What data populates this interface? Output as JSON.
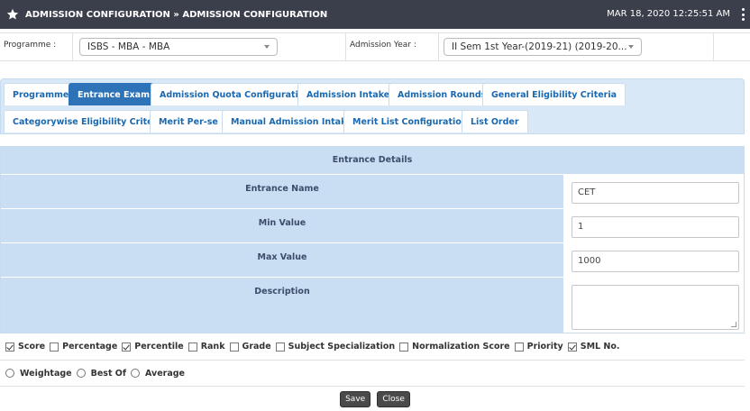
{
  "header": {
    "title": "ADMISSION CONFIGURATION » ADMISSION CONFIGURATION",
    "datetime": "MAR 18, 2020  12:25:51 AM"
  },
  "filters": {
    "programme_label": "Programme :",
    "programme_value": "ISBS - MBA - MBA",
    "admission_year_label": "Admission Year :",
    "admission_year_value": "II Sem 1st Year-(2019-21) (2019-20..."
  },
  "tabs": [
    {
      "label": "Programme",
      "active": false
    },
    {
      "label": "Entrance Exam",
      "active": true
    },
    {
      "label": "Admission Quota Configuration",
      "active": false
    },
    {
      "label": "Admission Intake",
      "active": false
    },
    {
      "label": "Admission Rounds",
      "active": false
    },
    {
      "label": "General Eligibility Criteria",
      "active": false
    },
    {
      "label": "Categorywise Eligibility Criteria",
      "active": false
    },
    {
      "label": "Merit Per-se",
      "active": false
    },
    {
      "label": "Manual Admission Intake",
      "active": false
    },
    {
      "label": "Merit List Configuration",
      "active": false
    },
    {
      "label": "List Order",
      "active": false
    }
  ],
  "details": {
    "heading": "Entrance Details",
    "fields": [
      {
        "label": "Entrance Name",
        "value": "CET"
      },
      {
        "label": "Min Value",
        "value": "1"
      },
      {
        "label": "Max Value",
        "value": "1000"
      },
      {
        "label": "Description",
        "value": ""
      }
    ]
  },
  "checkboxes": [
    {
      "label": "Score",
      "checked": true
    },
    {
      "label": "Percentage",
      "checked": false
    },
    {
      "label": "Percentile",
      "checked": true
    },
    {
      "label": "Rank",
      "checked": false
    },
    {
      "label": "Grade",
      "checked": false
    },
    {
      "label": "Subject Specialization",
      "checked": false
    },
    {
      "label": "Normalization Score",
      "checked": false
    },
    {
      "label": "Priority",
      "checked": false
    },
    {
      "label": "SML No.",
      "checked": true
    }
  ],
  "radios": [
    {
      "label": "Weightage",
      "checked": false
    },
    {
      "label": "Best Of",
      "checked": false
    },
    {
      "label": "Average",
      "checked": false
    }
  ],
  "actions": {
    "save_label": "Save",
    "close_label": "Close"
  },
  "colors": {
    "topbar": "#3a3f4b",
    "tab_active": "#2e73b8",
    "panel_blue": "#c9def3"
  }
}
